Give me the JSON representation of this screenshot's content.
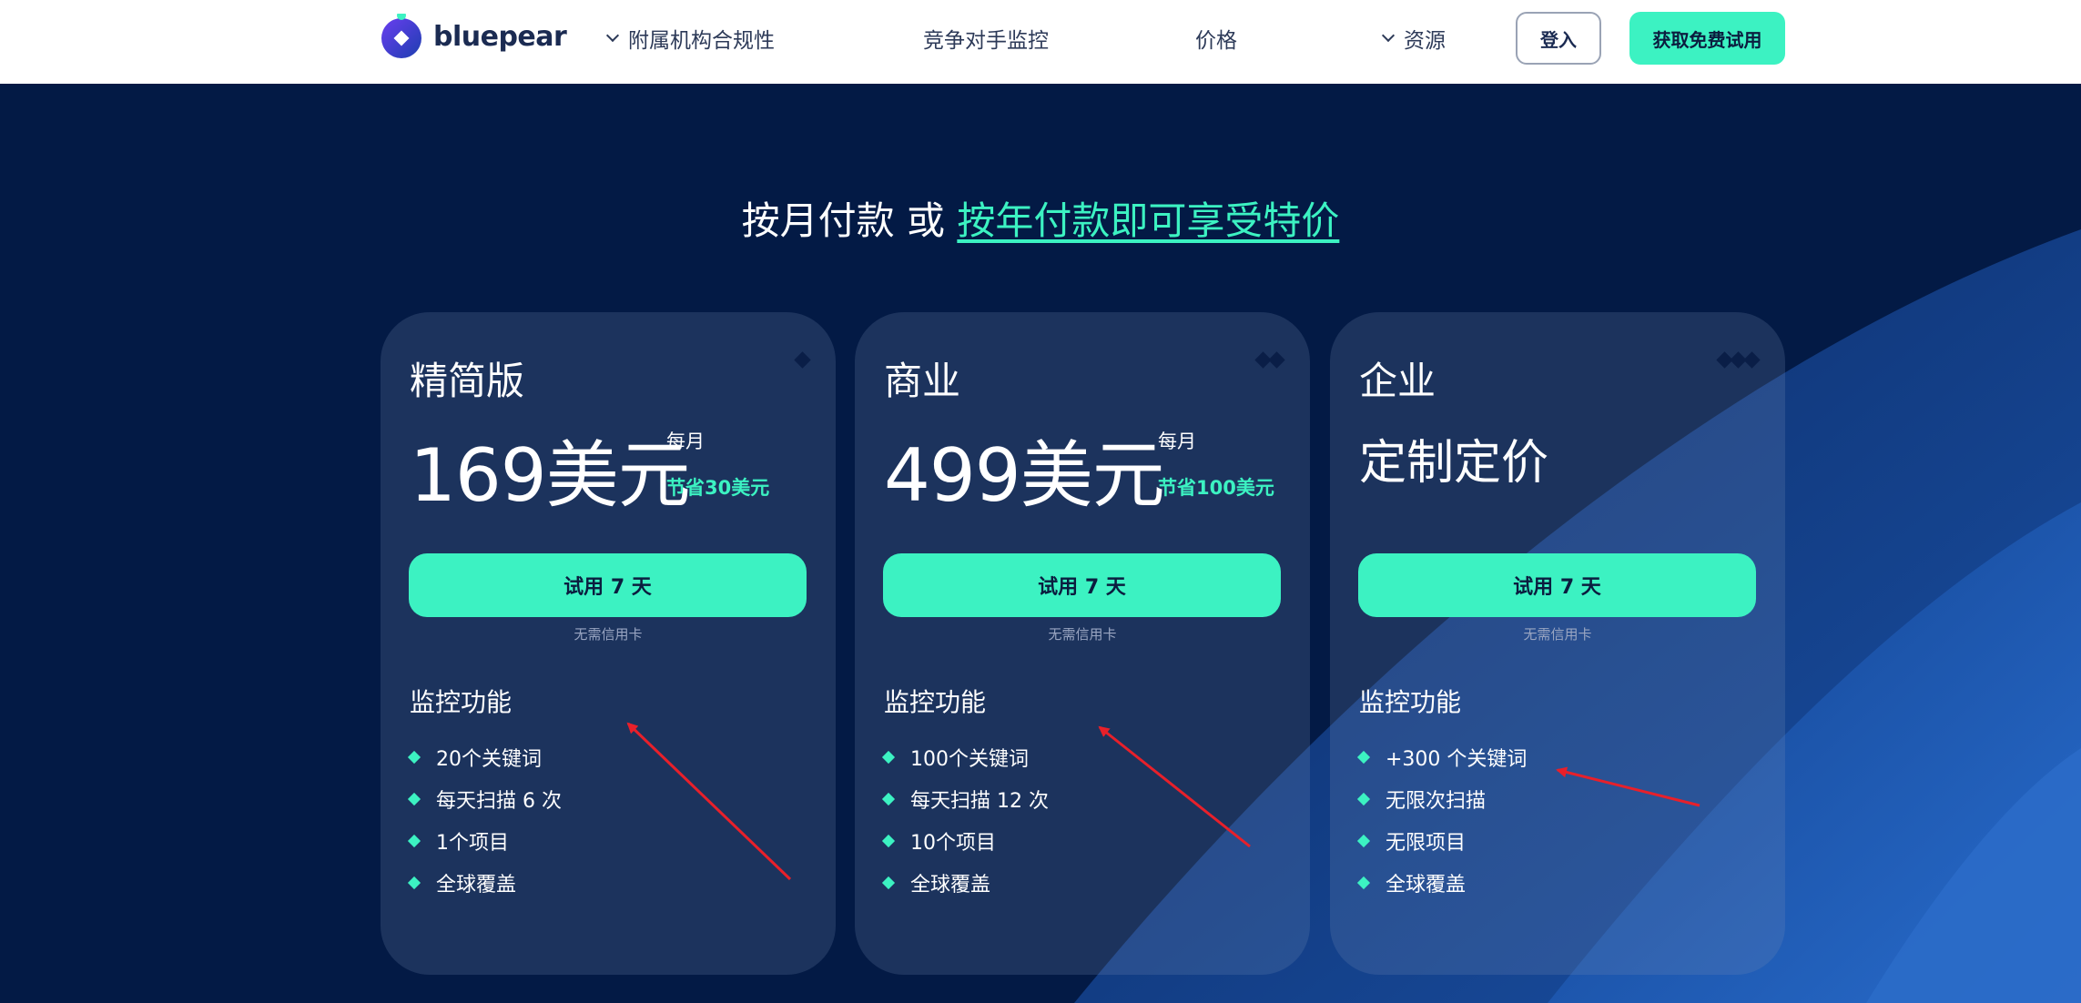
{
  "nav": {
    "logo_text": "bluepear",
    "items": [
      {
        "label": "附属机构合规性",
        "has_dropdown": true
      },
      {
        "label": "竞争对手监控",
        "has_dropdown": false
      },
      {
        "label": "价格",
        "has_dropdown": false
      },
      {
        "label": "资源",
        "has_dropdown": true
      }
    ],
    "login_label": "登入",
    "trial_label": "获取免费试用"
  },
  "headline": {
    "text": "按月付款 或 ",
    "link": "按年付款即可享受特价"
  },
  "plans": [
    {
      "name": "精简版",
      "price": "169美元",
      "period": "每月",
      "save": "节省30美元",
      "tier_dots": 1,
      "button": "试用 7 天",
      "note": "无需信用卡",
      "features_title": "监控功能",
      "features": [
        "20个关键词",
        "每天扫描 6 次",
        "1个项目",
        "全球覆盖"
      ]
    },
    {
      "name": "商业",
      "price": "499美元",
      "period": "每月",
      "save": "节省100美元",
      "tier_dots": 2,
      "button": "试用 7 天",
      "note": "无需信用卡",
      "features_title": "监控功能",
      "features": [
        "100个关键词",
        "每天扫描 12 次",
        "10个项目",
        "全球覆盖"
      ]
    },
    {
      "name": "企业",
      "price": "定制定价",
      "tier_dots": 3,
      "button": "试用 7 天",
      "note": "无需信用卡",
      "features_title": "监控功能",
      "features": [
        "+300 个关键词",
        "无限次扫描",
        "无限项目",
        "全球覆盖"
      ]
    }
  ],
  "colors": {
    "accent": "#3cf2c2",
    "background": "#031a45",
    "annotation_arrow": "#e8202a"
  }
}
